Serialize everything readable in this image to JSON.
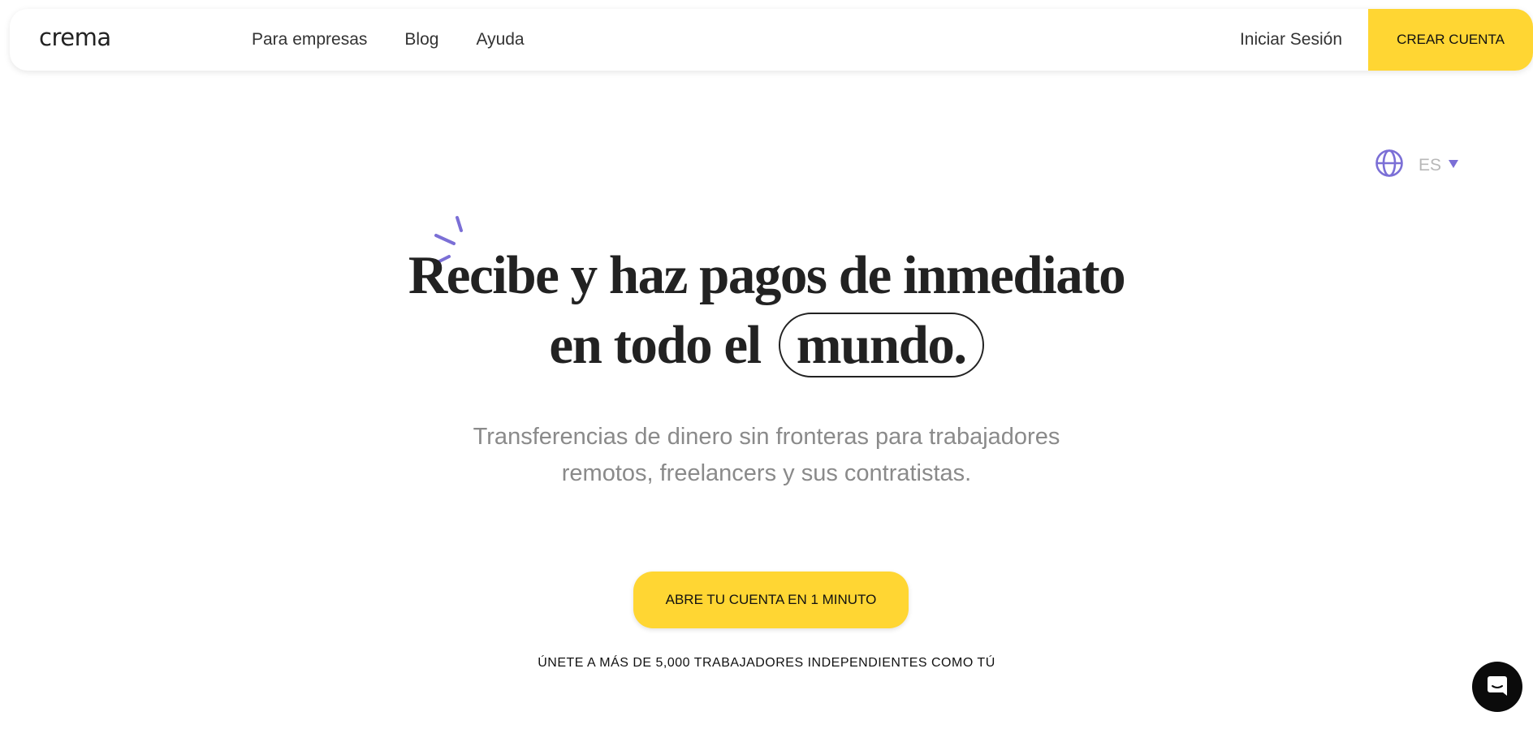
{
  "header": {
    "logo_text": "crema",
    "nav": [
      {
        "label": "Para empresas"
      },
      {
        "label": "Blog"
      },
      {
        "label": "Ayuda"
      }
    ],
    "login_label": "Iniciar Sesión",
    "signup_label": "CREAR CUENTA"
  },
  "language": {
    "code": "ES"
  },
  "hero": {
    "title_line1": "Recibe y haz pagos de inmediato",
    "title_line2_prefix": "en todo el",
    "title_highlight": "mundo.",
    "subtitle_line1": "Transferencias de dinero sin fronteras para trabajadores",
    "subtitle_line2": "remotos, freelancers y sus contratistas.",
    "cta_label": "ABRE TU CUENTA EN 1 MINUTO",
    "social_proof": "ÚNETE A MÁS DE 5,000 TRABAJADORES INDEPENDIENTES COMO TÚ"
  },
  "colors": {
    "accent_yellow": "#ffd633",
    "accent_purple": "#7b6fd6",
    "text_dark": "#222222",
    "text_muted": "#8a8a8a"
  },
  "icons": {
    "logo_mark": "leaf-c-icon",
    "language": "globe-icon",
    "dropdown": "caret-down-icon",
    "chat": "chat-bubble-icon",
    "decoration": "sparkle-icon"
  }
}
